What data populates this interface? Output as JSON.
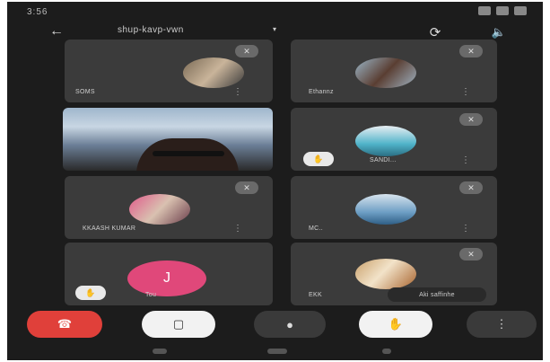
{
  "status_bar": {
    "time": "3:56"
  },
  "header": {
    "title": "shup-kavp-vwn",
    "caret": "▾"
  },
  "icons": {
    "back": "back-arrow-icon",
    "rotate": "switch-camera-icon",
    "speaker": "speaker-icon"
  },
  "tiles": [
    {
      "name": "SOMS"
    },
    {
      "name": "Ethannz"
    },
    {
      "name": ""
    },
    {
      "name": "SANDI..."
    },
    {
      "name": "KKAASH KUMAR"
    },
    {
      "name": "MC.."
    },
    {
      "name": "Tou",
      "initial": "J"
    },
    {
      "name": "EKK",
      "pill": "Aki saffinhe"
    }
  ],
  "colors": {
    "end_call": "#e0403a",
    "avatar_initial_bg": "#e0487a",
    "background": "#1c1c1c",
    "tile": "#3b3b3b"
  }
}
